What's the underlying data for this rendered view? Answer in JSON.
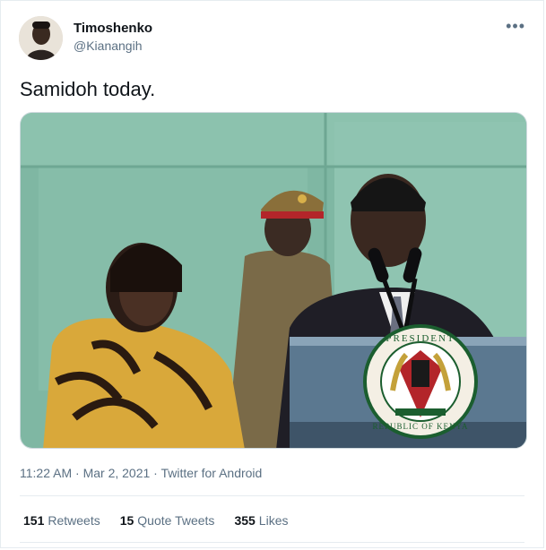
{
  "author": {
    "name": "Timoshenko",
    "handle": "@Kianangih"
  },
  "menu_icon": "more-horizontal-icon",
  "tweet": {
    "text": "Samidoh today."
  },
  "media": {
    "seal_top": "PRESIDENT",
    "seal_bottom": "REPUBLIC OF KENYA"
  },
  "meta": {
    "time": "11:22 AM",
    "separator": " · ",
    "date": "Mar 2, 2021",
    "source": "Twitter for Android"
  },
  "stats": [
    {
      "count": "151",
      "label": "Retweets"
    },
    {
      "count": "15",
      "label": "Quote Tweets"
    },
    {
      "count": "355",
      "label": "Likes"
    }
  ]
}
